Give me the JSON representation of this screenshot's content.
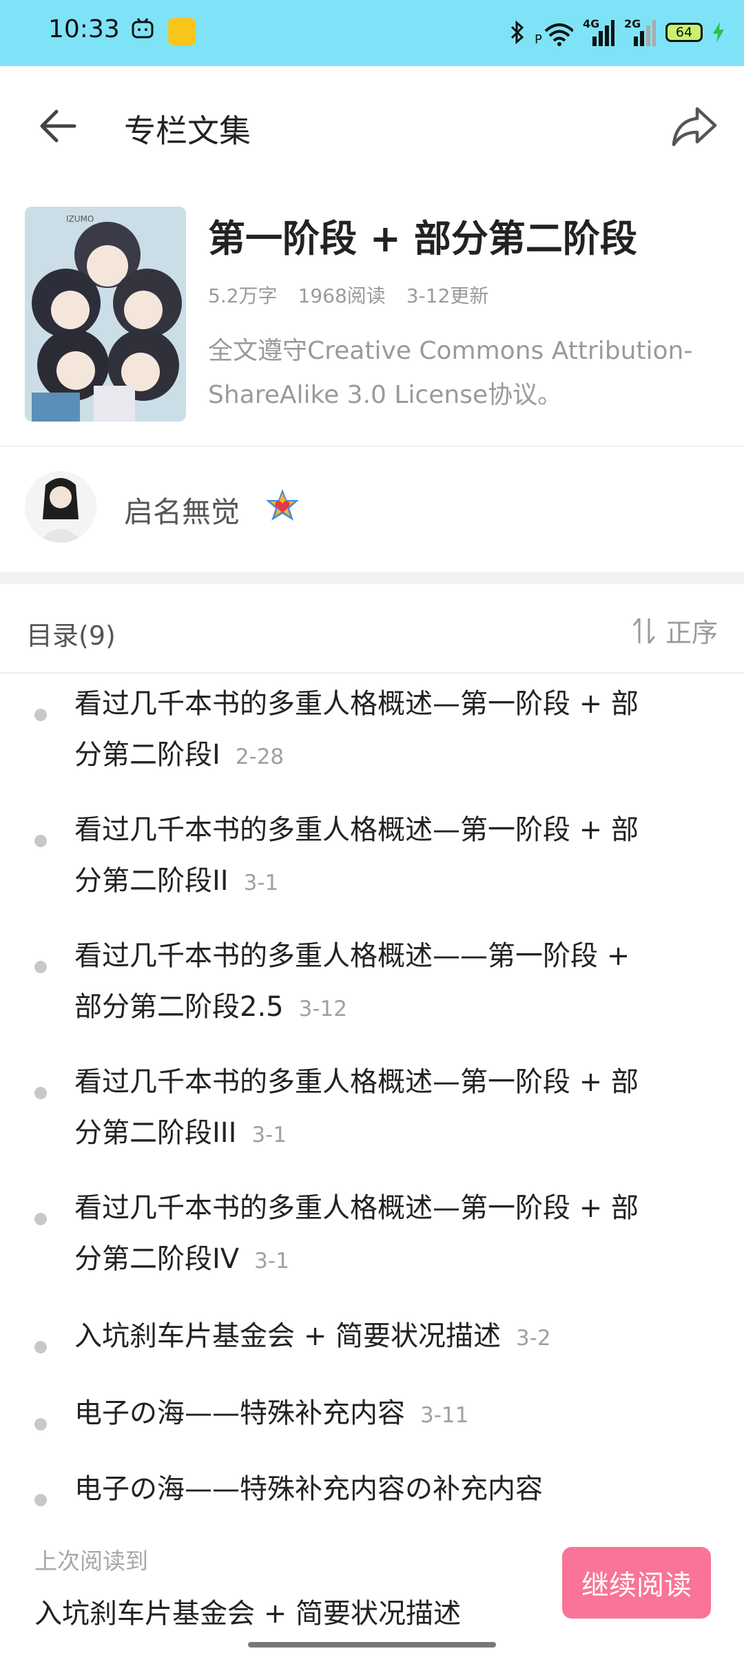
{
  "status_bar": {
    "time": "10:33",
    "battery": "64",
    "signal1": "4G",
    "signal2": "2G",
    "icons": [
      "bilibili-app-icon",
      "game-app-icon",
      "bluetooth-icon",
      "wifi-icon",
      "signal-4g-icon",
      "signal-2g-icon",
      "battery-icon",
      "charging-icon"
    ]
  },
  "app_bar": {
    "title": "专栏文集",
    "back_icon": "arrow-left-icon",
    "share_icon": "share-icon"
  },
  "collection": {
    "title": "第一阶段 + 部分第二阶段",
    "words": "5.2万字",
    "reads": "1968阅读",
    "updated": "3-12更新",
    "description": " 全文遵守Creative Commons Attribution-ShareAlike 3.0 License协议。"
  },
  "author": {
    "name": "启名無觉"
  },
  "toc": {
    "title": "目录(9)",
    "sort_label": "正序",
    "items": [
      {
        "title": "看过几千本书的多重人格概述—第一阶段 + 部分第二阶段I",
        "date": "2-28"
      },
      {
        "title": "看过几千本书的多重人格概述—第一阶段 + 部分第二阶段II",
        "date": "3-1"
      },
      {
        "title": "看过几千本书的多重人格概述——第一阶段 + 部分第二阶段2.5",
        "date": "3-12"
      },
      {
        "title": "看过几千本书的多重人格概述—第一阶段 + 部分第二阶段III",
        "date": "3-1"
      },
      {
        "title": "看过几千本书的多重人格概述—第一阶段 + 部分第二阶段IV",
        "date": "3-1"
      },
      {
        "title": "入坑刹车片基金会 + 简要状况描述",
        "date": "3-2"
      },
      {
        "title": "电子の海——特殊补充内容",
        "date": "3-11"
      },
      {
        "title": "电子の海——特殊补充内容の补充内容",
        "date": ""
      }
    ]
  },
  "bottom_bar": {
    "last_read_label": "上次阅读到",
    "last_read_title": "入坑刹车片基金会 + 简要状况描述",
    "continue_label": "继续阅读"
  },
  "colors": {
    "status_bar_bg": "#7fe3f7",
    "accent": "#f97496",
    "secondary_text": "#9a9a9a"
  }
}
